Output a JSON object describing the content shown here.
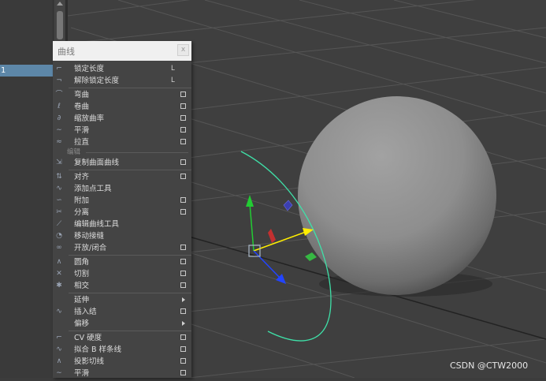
{
  "outliner": {
    "selected_item": "1"
  },
  "menu": {
    "title": "曲线",
    "close_glyph": "x",
    "items": [
      {
        "type": "item",
        "label": "锁定长度",
        "shortcut": "L",
        "icon": "lock-length-icon",
        "icon_glyph": "⌐"
      },
      {
        "type": "item",
        "label": "解除锁定长度",
        "shortcut": "L",
        "icon": "unlock-length-icon",
        "icon_glyph": "¬"
      },
      {
        "type": "sep"
      },
      {
        "type": "item",
        "label": "弯曲",
        "option": true,
        "icon": "bend-icon",
        "icon_glyph": "⌒"
      },
      {
        "type": "item",
        "label": "卷曲",
        "option": true,
        "icon": "curl-icon",
        "icon_glyph": "ℓ"
      },
      {
        "type": "item",
        "label": "缩放曲率",
        "option": true,
        "icon": "scale-curvature-icon",
        "icon_glyph": "∂"
      },
      {
        "type": "item",
        "label": "平滑",
        "option": true,
        "icon": "smooth-icon",
        "icon_glyph": "∼"
      },
      {
        "type": "item",
        "label": "拉直",
        "option": true,
        "icon": "straighten-icon",
        "icon_glyph": "≈"
      },
      {
        "type": "section",
        "label": "编辑"
      },
      {
        "type": "item",
        "label": "复制曲面曲线",
        "option": true,
        "icon": "duplicate-surface-curves-icon",
        "icon_glyph": "⇲"
      },
      {
        "type": "sep"
      },
      {
        "type": "item",
        "label": "对齐",
        "option": true,
        "icon": "align-icon",
        "icon_glyph": "⇅"
      },
      {
        "type": "item",
        "label": "添加点工具",
        "icon": "add-points-tool-icon",
        "icon_glyph": "∿"
      },
      {
        "type": "item",
        "label": "附加",
        "option": true,
        "icon": "attach-icon",
        "icon_glyph": "∽"
      },
      {
        "type": "item",
        "label": "分离",
        "option": true,
        "icon": "detach-icon",
        "icon_glyph": "✂"
      },
      {
        "type": "item",
        "label": "编辑曲线工具",
        "icon": "edit-curve-tool-icon",
        "icon_glyph": "⟋"
      },
      {
        "type": "item",
        "label": "移动接缝",
        "icon": "move-seam-icon",
        "icon_glyph": "◔"
      },
      {
        "type": "item",
        "label": "开放/闭合",
        "option": true,
        "icon": "open-close-icon",
        "icon_glyph": "∞"
      },
      {
        "type": "sep"
      },
      {
        "type": "item",
        "label": "圆角",
        "option": true,
        "icon": "fillet-icon",
        "icon_glyph": "∧"
      },
      {
        "type": "item",
        "label": "切割",
        "option": true,
        "icon": "cut-icon",
        "icon_glyph": "✕"
      },
      {
        "type": "item",
        "label": "相交",
        "option": true,
        "icon": "intersect-icon",
        "icon_glyph": "✱"
      },
      {
        "type": "sep"
      },
      {
        "type": "item",
        "label": "延伸",
        "submenu": true,
        "icon": "",
        "icon_glyph": ""
      },
      {
        "type": "item",
        "label": "插入结",
        "option": true,
        "icon": "insert-knot-icon",
        "icon_glyph": "∿"
      },
      {
        "type": "item",
        "label": "偏移",
        "submenu": true,
        "icon": "",
        "icon_glyph": ""
      },
      {
        "type": "sep"
      },
      {
        "type": "item",
        "label": "CV 硬度",
        "option": true,
        "icon": "cv-hardness-icon",
        "icon_glyph": "⌐"
      },
      {
        "type": "item",
        "label": "拟合 B 样条线",
        "option": true,
        "icon": "fit-bspline-icon",
        "icon_glyph": "∿"
      },
      {
        "type": "item",
        "label": "投影切线",
        "option": true,
        "icon": "project-tangent-icon",
        "icon_glyph": "∧"
      },
      {
        "type": "item",
        "label": "平滑",
        "option": true,
        "icon": "smooth-2-icon",
        "icon_glyph": "∼"
      }
    ]
  },
  "watermark": "CSDN @CTW2000",
  "colors": {
    "curve": "#3fe0a8",
    "y_axis": "#22cc33",
    "x_axis": "#ffee00",
    "z_axis": "#2244ff",
    "menu_bg": "#444444",
    "selection": "#5d87a8"
  }
}
